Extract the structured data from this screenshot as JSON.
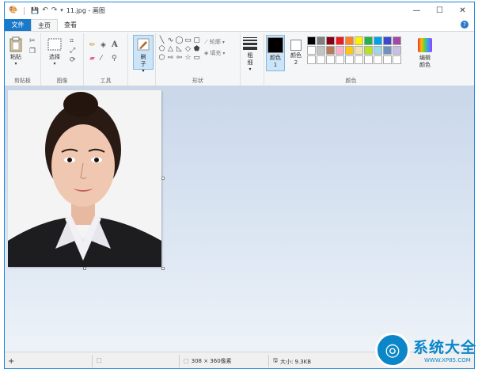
{
  "window": {
    "title": "11.jpg - 画图",
    "controls": {
      "minimize": "—",
      "maximize": "☐",
      "close": "✕"
    }
  },
  "quick_access": {
    "save": "💾",
    "undo": "↶",
    "redo": "↷",
    "menu": "▾"
  },
  "tabs": [
    {
      "label": "文件"
    },
    {
      "label": "主页"
    },
    {
      "label": "查看"
    }
  ],
  "ribbon": {
    "clipboard": {
      "paste_label": "粘贴",
      "group_label": "剪贴板"
    },
    "image": {
      "select_label": "选择",
      "group_label": "图像"
    },
    "tools": {
      "group_label": "工具",
      "text_glyph": "A"
    },
    "brushes": {
      "label": "刷子"
    },
    "shapes": {
      "outline_label": "轮廓",
      "fill_label": "填充",
      "group_label": "形状"
    },
    "size": {
      "label": "粗细"
    },
    "colors": {
      "color1_label": "颜色 1",
      "color2_label": "颜色 2",
      "edit_label": "编辑颜色",
      "group_label": "颜色",
      "color1_value": "#000000",
      "color2_value": "#ffffff",
      "palette_row1": [
        "#000000",
        "#7f7f7f",
        "#880015",
        "#ed1c24",
        "#ff7f27",
        "#fff200",
        "#22b14c",
        "#00a2e8",
        "#3f48cc",
        "#a349a4"
      ],
      "palette_row2": [
        "#ffffff",
        "#c3c3c3",
        "#b97a57",
        "#ffaec9",
        "#ffc90e",
        "#efe4b0",
        "#b5e61d",
        "#99d9ea",
        "#7092be",
        "#c8bfe7"
      ],
      "palette_row3": [
        "#ffffff",
        "#ffffff",
        "#ffffff",
        "#ffffff",
        "#ffffff",
        "#ffffff",
        "#ffffff",
        "#ffffff",
        "#ffffff",
        "#ffffff"
      ]
    }
  },
  "status": {
    "add_icon": "+",
    "dimensions": "308 × 360像素",
    "size": "大小: 9.3KB"
  },
  "watermark": {
    "text": "系统大全",
    "sub": "WWW.XP85.COM"
  },
  "accent_color": "#1979ca"
}
